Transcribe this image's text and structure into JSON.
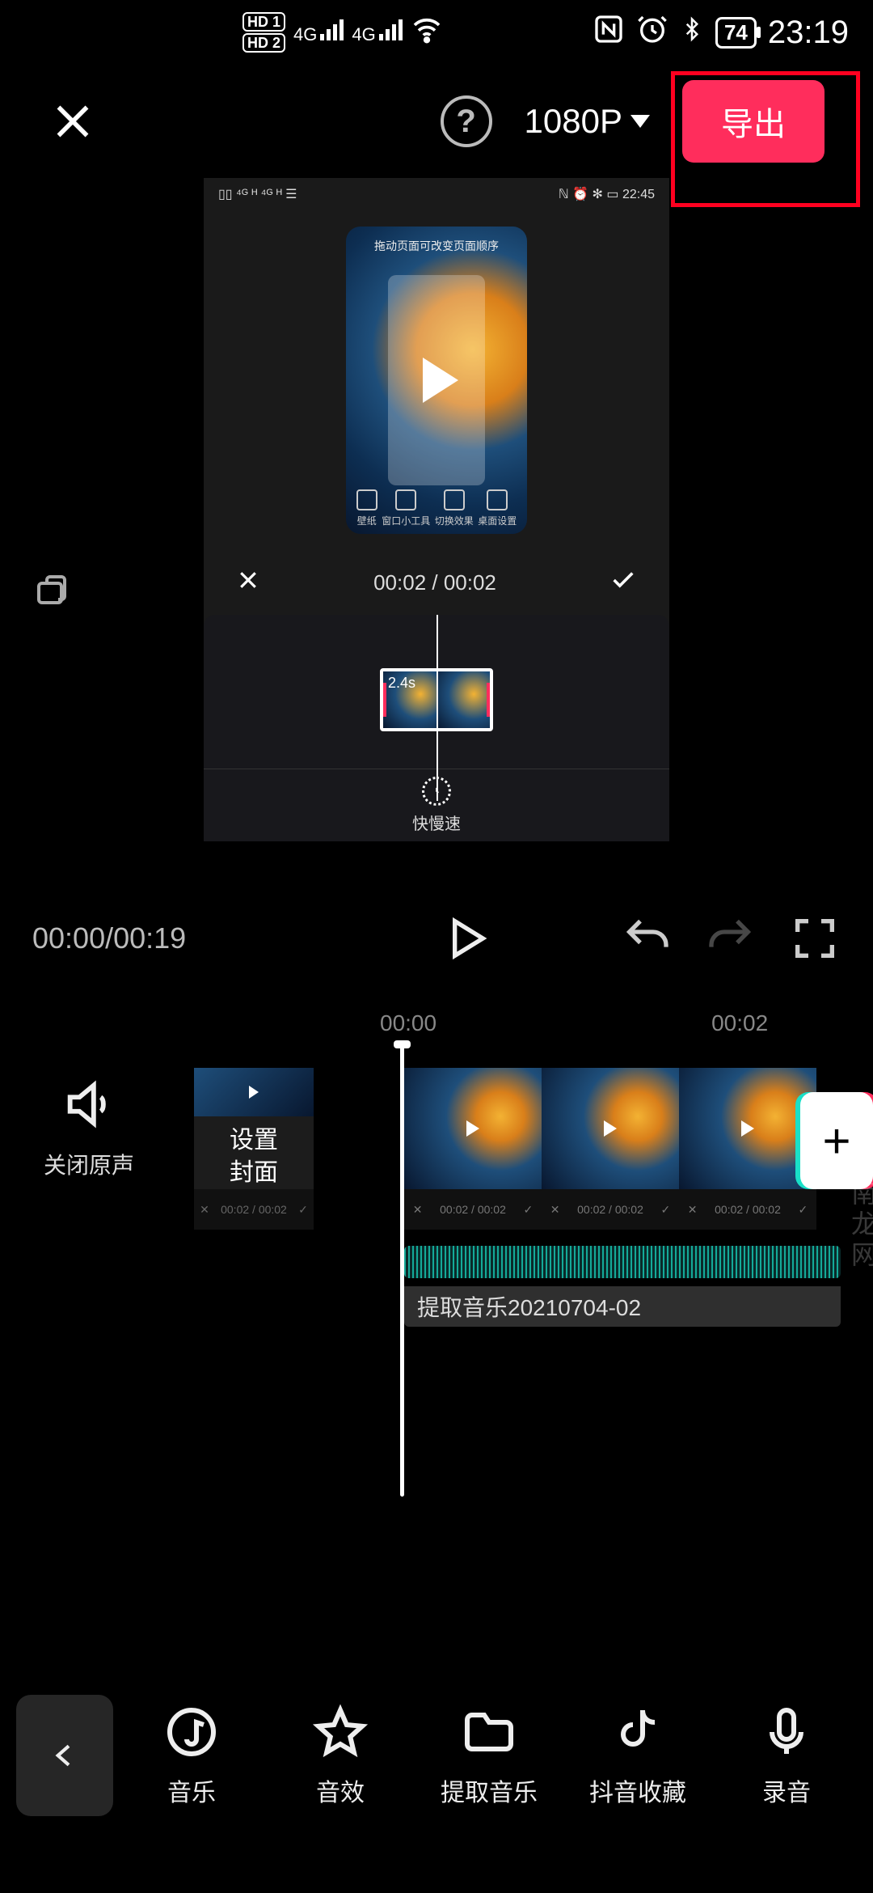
{
  "status": {
    "hd1": "HD 1",
    "hd2": "HD 2",
    "net1": "4G",
    "net2": "4G",
    "battery": "74",
    "time": "23:19"
  },
  "topbar": {
    "help": "?",
    "resolution": "1080P",
    "export": "导出"
  },
  "preview": {
    "inner_status_left": "",
    "inner_status_time": "22:45",
    "phone_hint": "拖动页面可改变页面顺序",
    "dock": [
      "壁纸",
      "窗口小工具",
      "切换效果",
      "桌面设置"
    ],
    "ctrl_time": "00:02 / 00:02",
    "clip_label": "2.4s",
    "speed_label": "快慢速"
  },
  "controls": {
    "time": "00:00/00:19"
  },
  "ruler": {
    "t0": "00:00",
    "t1": "00:02"
  },
  "tracks": {
    "mute_label": "关闭原声",
    "cover_label": "设置\n封面",
    "audio_label": "提取音乐20210704-02",
    "clip_strip_time": "00:02 / 00:02"
  },
  "bottom": {
    "items": [
      {
        "label": "音乐"
      },
      {
        "label": "音效"
      },
      {
        "label": "提取音乐"
      },
      {
        "label": "抖音收藏"
      },
      {
        "label": "录音"
      }
    ]
  },
  "watermark": "河南龙网"
}
